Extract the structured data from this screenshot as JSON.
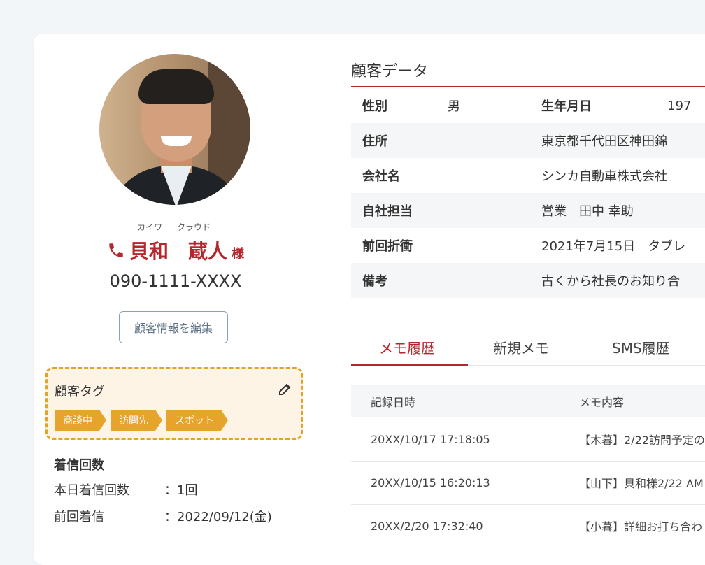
{
  "customer": {
    "name_ruby_family": "カイワ",
    "name_ruby_given": "クラウド",
    "family_name": "貝和",
    "given_name": "蔵人",
    "honorific": "様",
    "phone": "090-1111-XXXX",
    "edit_button_label": "顧客情報を編集"
  },
  "tags": {
    "title": "顧客タグ",
    "items": [
      "商談中",
      "訪問先",
      "スポット"
    ],
    "tag_color": "#e6a42a"
  },
  "calls": {
    "title": "着信回数",
    "rows": [
      {
        "label": "本日着信回数",
        "value": "：1回"
      },
      {
        "label": "前回着信",
        "value": "：2022/09/12(金)"
      }
    ]
  },
  "customer_data": {
    "title": "顧客データ",
    "rows": [
      {
        "key": "性別",
        "value": "男",
        "key2": "生年月日",
        "value2": "197"
      },
      {
        "key": "住所",
        "value": "東京都千代田区神田錦"
      },
      {
        "key": "会社名",
        "value": "シンカ自動車株式会社"
      },
      {
        "key": "自社担当",
        "value": "営業　田中 幸助"
      },
      {
        "key": "前回折衝",
        "value": "2021年7月15日　タブレ"
      },
      {
        "key": "備考",
        "value": "古くから社長のお知り合"
      }
    ]
  },
  "tabs": [
    "メモ履歴",
    "新規メモ",
    "SMS履歴"
  ],
  "memo_table": {
    "headers": [
      "記録日時",
      "メモ内容"
    ],
    "rows": [
      {
        "datetime": "20XX/10/17 17:18:05",
        "content": "【木暮】2/22訪問予定の"
      },
      {
        "datetime": "20XX/10/15 16:20:13",
        "content": "【山下】貝和様2/22 AM"
      },
      {
        "datetime": "20XX/2/20 17:32:40",
        "content": "【小暮】詳細お打ち合わ"
      }
    ]
  },
  "colors": {
    "accent": "#b3282d",
    "tag": "#e6a42a",
    "tag_bg": "#fdf4e5"
  }
}
